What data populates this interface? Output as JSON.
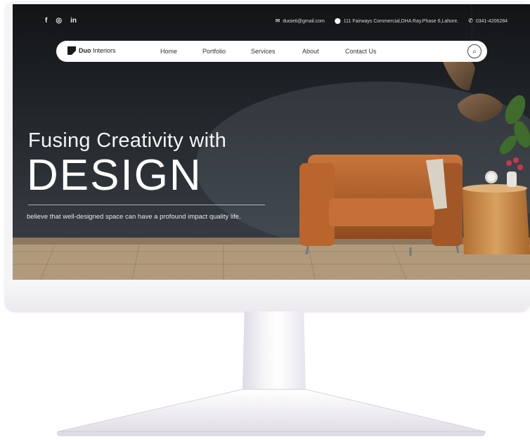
{
  "topbar": {
    "social": [
      "f",
      "◎",
      "in"
    ],
    "email": "duoieti@gmail.com",
    "address": "111 Fairways Commercial,DHA Ray.Phase 6,Lahore.",
    "phone": "0341-4206284"
  },
  "nav": {
    "brand_bold": "Duo",
    "brand_rest": " Interiors",
    "links": [
      "Home",
      "Portfolio",
      "Services",
      "About",
      "Contact Us"
    ]
  },
  "hero": {
    "subtitle": "Fusing Creativity with",
    "title": "DESIGN",
    "tagline": "believe that well-designed space can have a profound impact quality life."
  },
  "icons": {
    "email": "mail-icon",
    "address": "location-pin-icon",
    "phone": "phone-icon",
    "search": "search-icon"
  },
  "colors": {
    "wall": "#2b3035",
    "sofa": "#b5622b",
    "table": "#c98a4a",
    "floor": "#bda584",
    "monitor": "#f4f4f6"
  }
}
